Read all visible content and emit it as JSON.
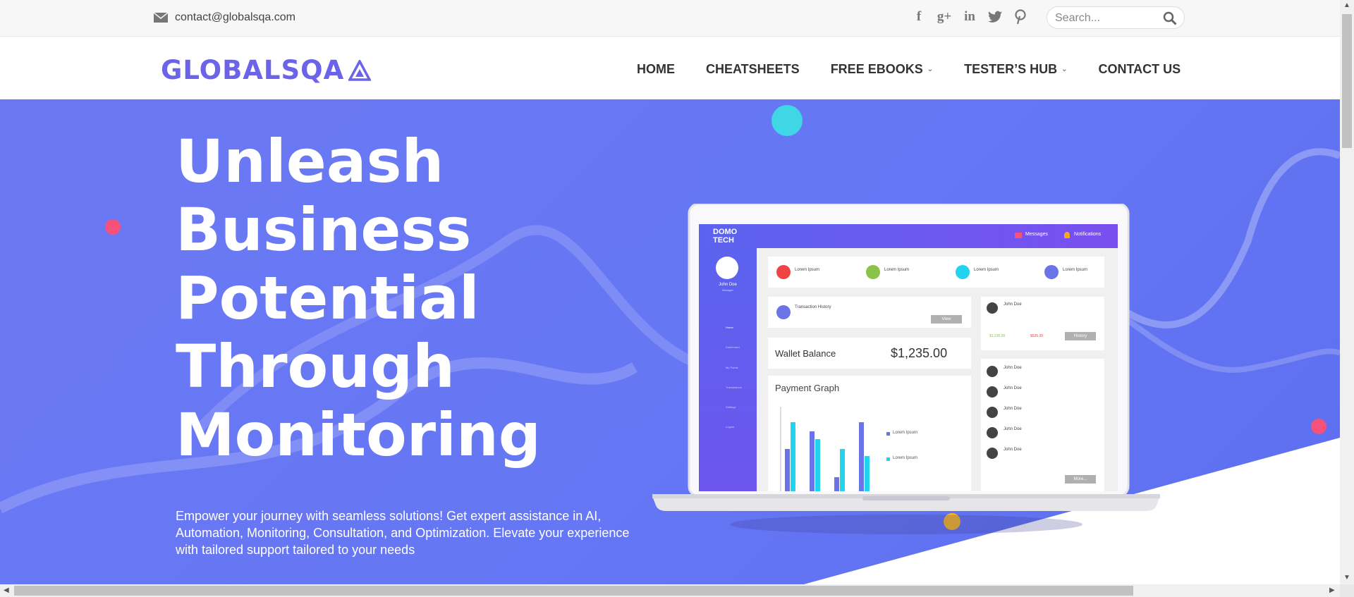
{
  "topbar": {
    "email": "contact@globalsqa.com",
    "social": [
      {
        "name": "facebook-icon",
        "glyph": "f"
      },
      {
        "name": "google-plus-icon",
        "glyph": "g+"
      },
      {
        "name": "linkedin-icon",
        "glyph": "in"
      },
      {
        "name": "twitter-icon",
        "glyph": "t"
      },
      {
        "name": "pinterest-icon",
        "glyph": "p"
      }
    ],
    "search_placeholder": "Search..."
  },
  "logo": {
    "text": "GLOBALSQA"
  },
  "nav": {
    "items": [
      {
        "label": "HOME",
        "dropdown": false
      },
      {
        "label": "CHEATSHEETS",
        "dropdown": false
      },
      {
        "label": "FREE EBOOKS",
        "dropdown": true
      },
      {
        "label": "TESTER’S HUB",
        "dropdown": true
      },
      {
        "label": "CONTACT US",
        "dropdown": false
      }
    ]
  },
  "hero": {
    "headline_lines": [
      "Unleash",
      "Business",
      "Potential",
      "Through",
      "Monitoring"
    ],
    "subtext": "Empower your journey with seamless solutions! Get expert assistance in AI, Automation, Monitoring, Consultation, and Optimization. Elevate your experience with tailored support tailored to your needs"
  },
  "dashboard": {
    "brand": "DOMO TECH",
    "header_items": [
      "Messages",
      "Notifications"
    ],
    "user_name": "John Doe",
    "user_role": "Manager",
    "menu": [
      "Home",
      "Dashboard",
      "My Points",
      "Transactions",
      "Settings",
      "Logout"
    ],
    "stats": [
      {
        "label": "Lorem Ipsum",
        "color": "#ef4444"
      },
      {
        "label": "Lorem Ipsum",
        "color": "#8bc34a"
      },
      {
        "label": "Lorem Ipsum",
        "color": "#22d3ee"
      },
      {
        "label": "Lorem Ipsum",
        "color": "#6b74e6"
      }
    ],
    "transaction_title": "Transaction History",
    "view_label": "View",
    "wallet_label": "Wallet Balance",
    "wallet_value": "$1,235.00",
    "graph_title": "Payment Graph",
    "graph_legend": [
      "Lorem Ipsum",
      "Lorem Ipsum"
    ],
    "history_amount_up": "$1,235.00",
    "history_amount_down": "$535.00",
    "history_label": "History",
    "contacts": [
      "John Doe",
      "John Doe",
      "John Doe",
      "John Doe",
      "John Doe",
      "John Doe"
    ],
    "more_label": "More..."
  },
  "colors": {
    "accent": "#6b64e8",
    "hero": "#6577f4"
  }
}
